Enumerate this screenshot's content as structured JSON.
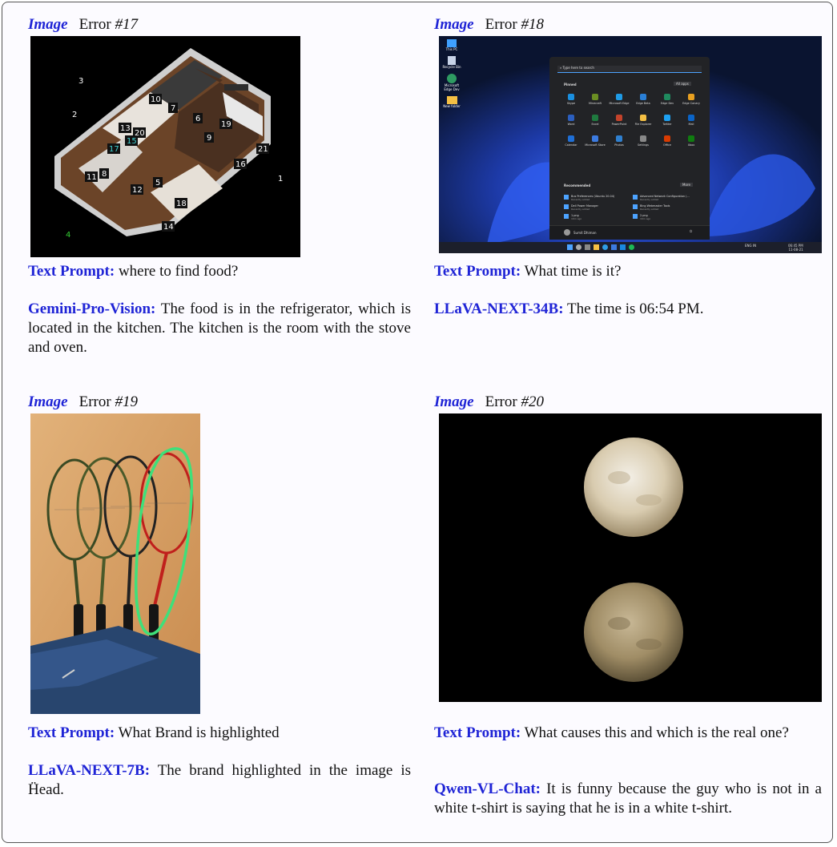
{
  "panels": [
    {
      "image_tag": "Image",
      "error_prefix": "Error ",
      "error_num": "#17",
      "prompt_label": "Text Prompt:",
      "prompt": "where to find food?",
      "model_label": "Gemini-Pro-Vision:",
      "answer": "The food is in the refrigerator, which is located in the kitchen. The kitchen is the room with the stove and oven.",
      "floorplan_labels": [
        "1",
        "2",
        "3",
        "4",
        "5",
        "6",
        "7",
        "8",
        "9",
        "10",
        "11",
        "12",
        "13",
        "14",
        "15",
        "16",
        "17",
        "18",
        "19",
        "20",
        "21"
      ]
    },
    {
      "image_tag": "Image",
      "error_prefix": "Error ",
      "error_num": "#18",
      "prompt_label": "Text Prompt:",
      "prompt": "What time is it?",
      "model_label": "LLaVA-NEXT-34B:",
      "answer": "The time is 06:54 PM.",
      "screen": {
        "search_placeholder": "Type here to search",
        "pinned_label": "Pinned",
        "all_apps_label": "All apps",
        "recommended_label": "Recommended",
        "more_label": "More",
        "user_name": "Sumit Dhiman",
        "apps": [
          "Skype",
          "Minecraft",
          "Microsoft Edge",
          "Edge Beta",
          "Edge Dev",
          "Edge Canary",
          "Word",
          "Excel",
          "PowerPoint",
          "File Explorer",
          "Twitter",
          "Mail",
          "Calendar",
          "Microsoft Store",
          "Photos",
          "Settings",
          "Office",
          "Xbox"
        ],
        "recommended": [
          {
            "title": "Bus Preferences (Ubuntu 20.04)",
            "sub": "Recently added"
          },
          {
            "title": "Advanced Network Configuration (...",
            "sub": "Recently added"
          },
          {
            "title": "Dell Power Manager",
            "sub": "Recently added"
          },
          {
            "title": "Bing Webmaster Tools",
            "sub": "Recently added"
          },
          {
            "title": "1.png",
            "sub": "16m ago"
          },
          {
            "title": "2.png",
            "sub": "16m ago"
          }
        ],
        "desktop_icons": [
          "This PC",
          "Recycle Bin",
          "Microsoft Edge Dev",
          "New folder"
        ],
        "tray_lang": "ENG IN",
        "clock_time": "06:45 PM",
        "clock_date": "11-08-21"
      }
    },
    {
      "image_tag": "Image",
      "error_prefix": "Error ",
      "error_num": "#19",
      "prompt_label": "Text Prompt:",
      "prompt": "What Brand is highlighted",
      "model_label": "LLaVA-NEXT-7B:",
      "answer": "The brand highlighted in the image is Ḧead."
    },
    {
      "image_tag": "Image",
      "error_prefix": "Error ",
      "error_num": "#20",
      "prompt_label": "Text Prompt:",
      "prompt": "What causes this and which is the real one?",
      "model_label": "Qwen-VL-Chat:",
      "answer": "It is funny because the guy who is not in a white t-shirt is saying that he is in a white t-shirt."
    }
  ]
}
